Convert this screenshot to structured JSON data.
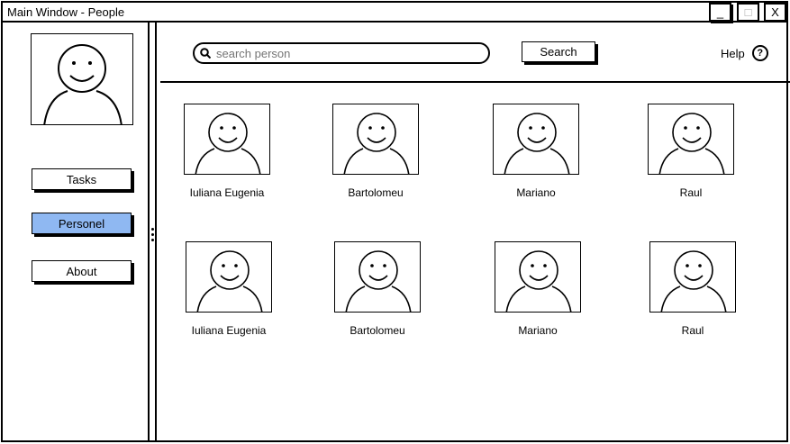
{
  "window": {
    "title": "Main Window - People",
    "controls": {
      "minimize": "_",
      "maximize": "□",
      "close": "X"
    }
  },
  "sidebar": {
    "avatar_icon": "person-avatar-icon",
    "items": [
      {
        "label": "Tasks",
        "active": false
      },
      {
        "label": "Personel",
        "active": true
      },
      {
        "label": "About",
        "active": false
      }
    ],
    "active_color": "#8fb8f2"
  },
  "toolbar": {
    "search_placeholder": "search person",
    "search_value": "",
    "search_button": "Search",
    "help_label": "Help",
    "help_icon": "?"
  },
  "people": [
    {
      "name": "Iuliana Eugenia"
    },
    {
      "name": "Bartolomeu"
    },
    {
      "name": "Mariano"
    },
    {
      "name": "Raul"
    },
    {
      "name": "Iuliana Eugenia"
    },
    {
      "name": "Bartolomeu"
    },
    {
      "name": "Mariano"
    },
    {
      "name": "Raul"
    }
  ]
}
